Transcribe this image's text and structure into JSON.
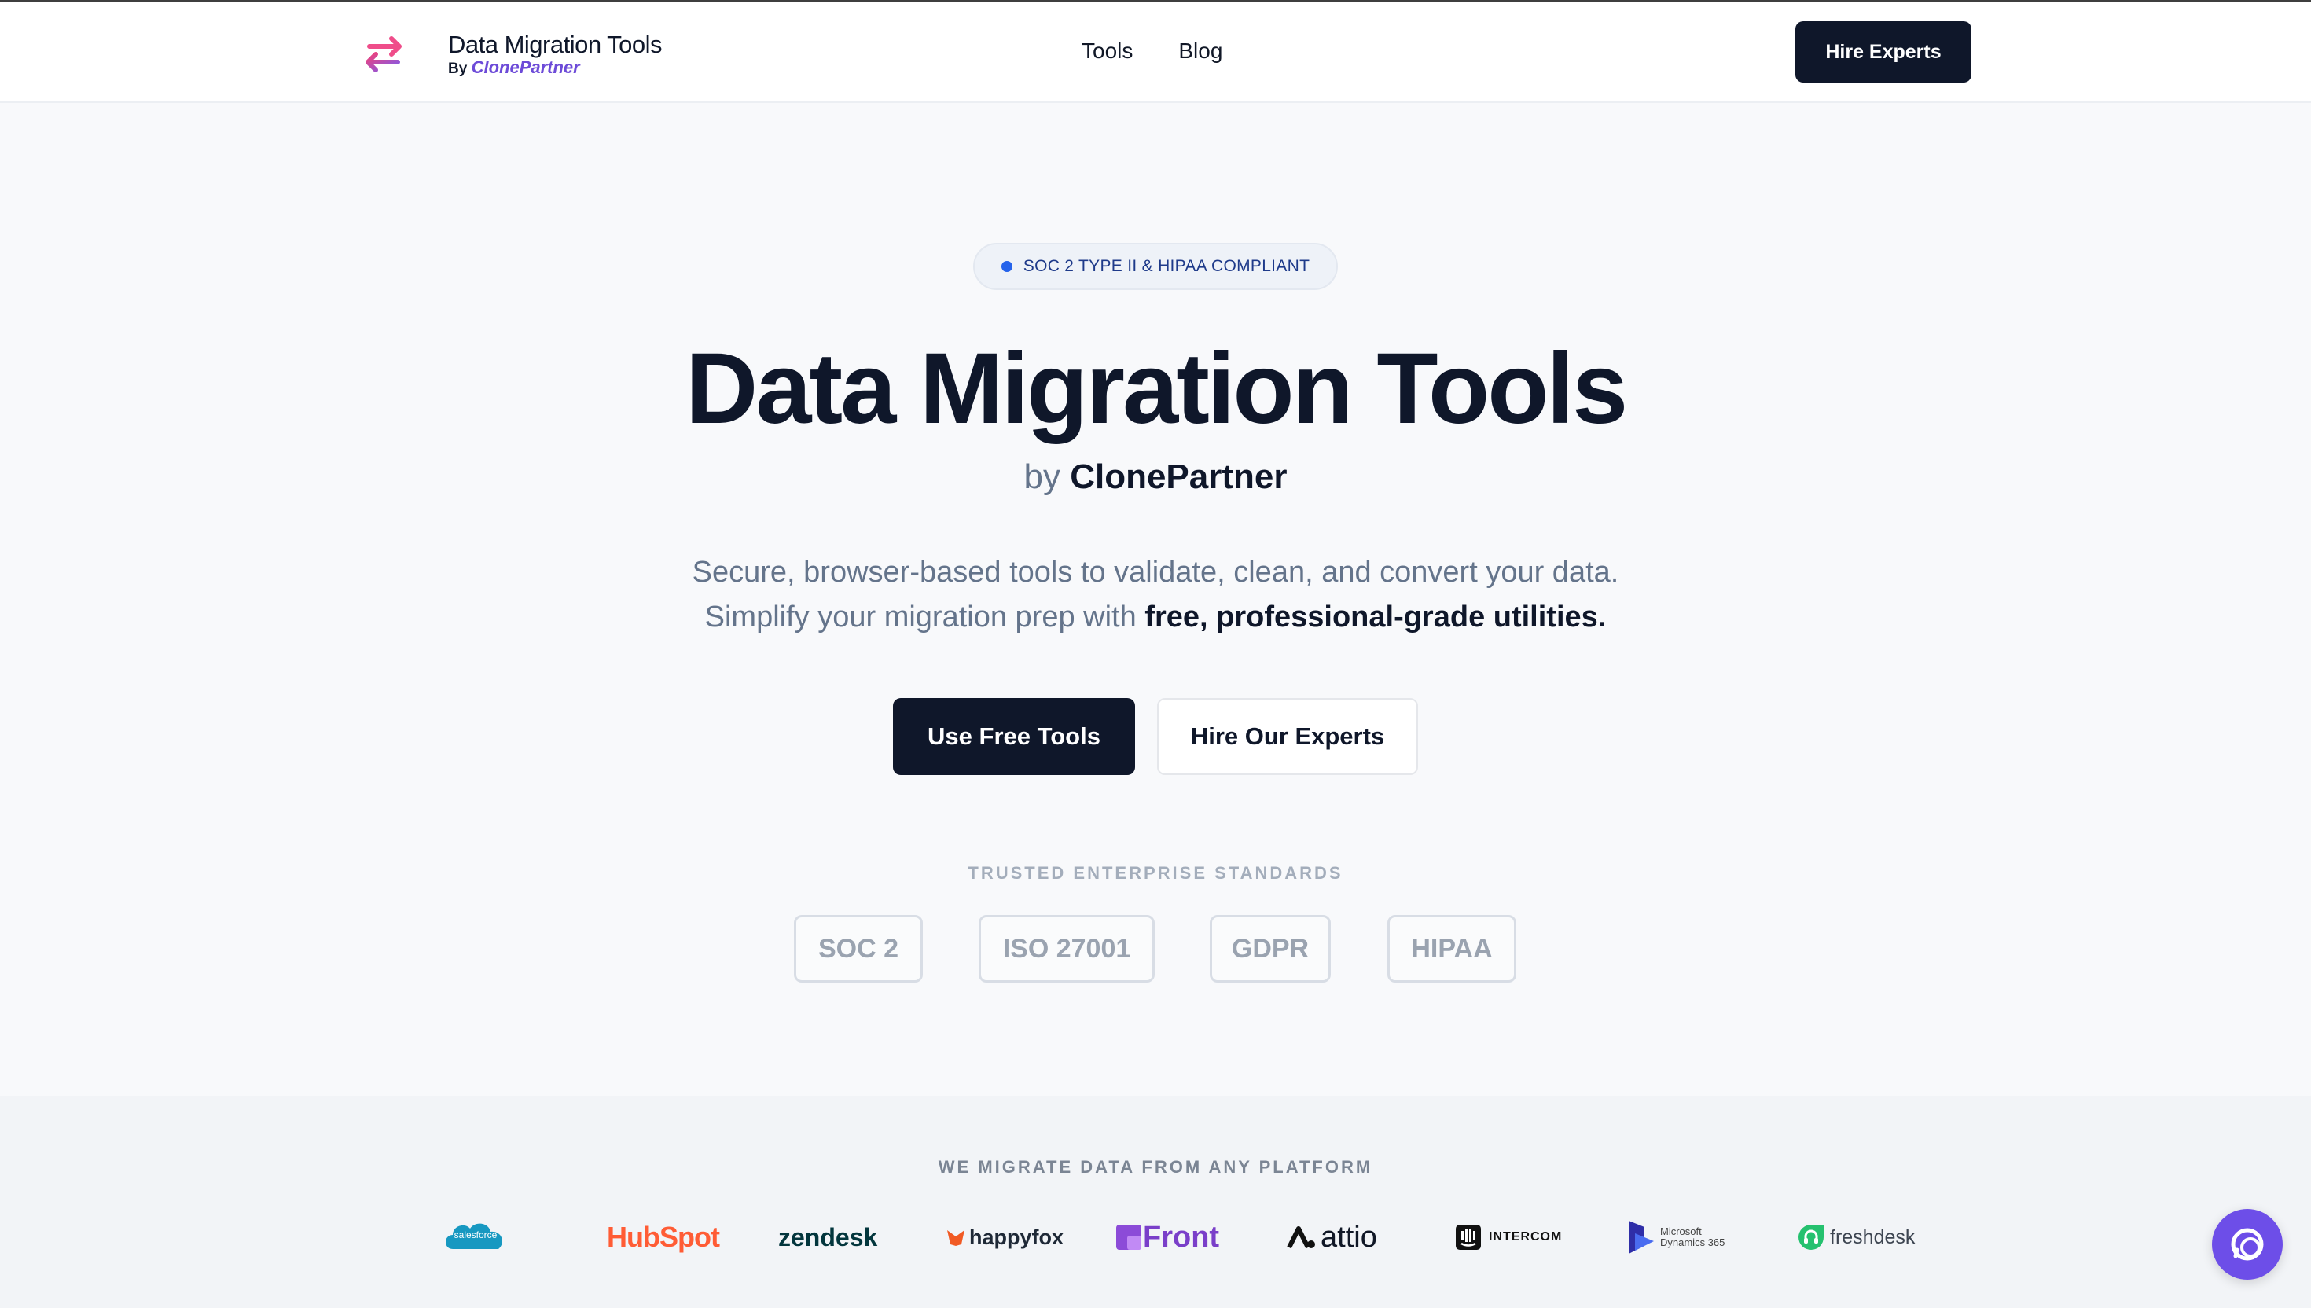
{
  "header": {
    "logo_title": "Data Migration Tools",
    "logo_by": "By",
    "logo_brand": "ClonePartner",
    "nav": [
      {
        "label": "Tools"
      },
      {
        "label": "Blog"
      }
    ],
    "hire_button": "Hire Experts"
  },
  "hero": {
    "badge": "SOC 2 TYPE II & HIPAA COMPLIANT",
    "title": "Data Migration Tools",
    "by_prefix": "by",
    "by_brand": "ClonePartner",
    "desc_line1": "Secure, browser-based tools to validate, clean, and convert your data.",
    "desc_line2_prefix": "Simplify your migration prep with",
    "desc_line2_bold": "free, professional-grade utilities.",
    "primary_cta": "Use Free Tools",
    "secondary_cta": "Hire Our Experts"
  },
  "standards": {
    "title": "TRUSTED ENTERPRISE STANDARDS",
    "items": [
      {
        "label": "SOC 2"
      },
      {
        "label": "ISO 27001"
      },
      {
        "label": "GDPR"
      },
      {
        "label": "HIPAA"
      }
    ]
  },
  "platforms": {
    "title": "WE MIGRATE DATA FROM ANY PLATFORM",
    "items": [
      {
        "label": "salesforce"
      },
      {
        "label": "HubSpot"
      },
      {
        "label": "zendesk"
      },
      {
        "label": "happyfox"
      },
      {
        "label": "Front"
      },
      {
        "label": "attio"
      },
      {
        "label": "INTERCOM"
      },
      {
        "label": "Microsoft"
      },
      {
        "label": "Dynamics 365"
      },
      {
        "label": "freshdesk"
      }
    ]
  },
  "colors": {
    "primary": "#0f172a",
    "accent_purple": "#6d4ee8",
    "badge_dot": "#2563eb"
  },
  "icons": {
    "logo": "swap-arrows-icon",
    "chat": "chat-icon"
  }
}
